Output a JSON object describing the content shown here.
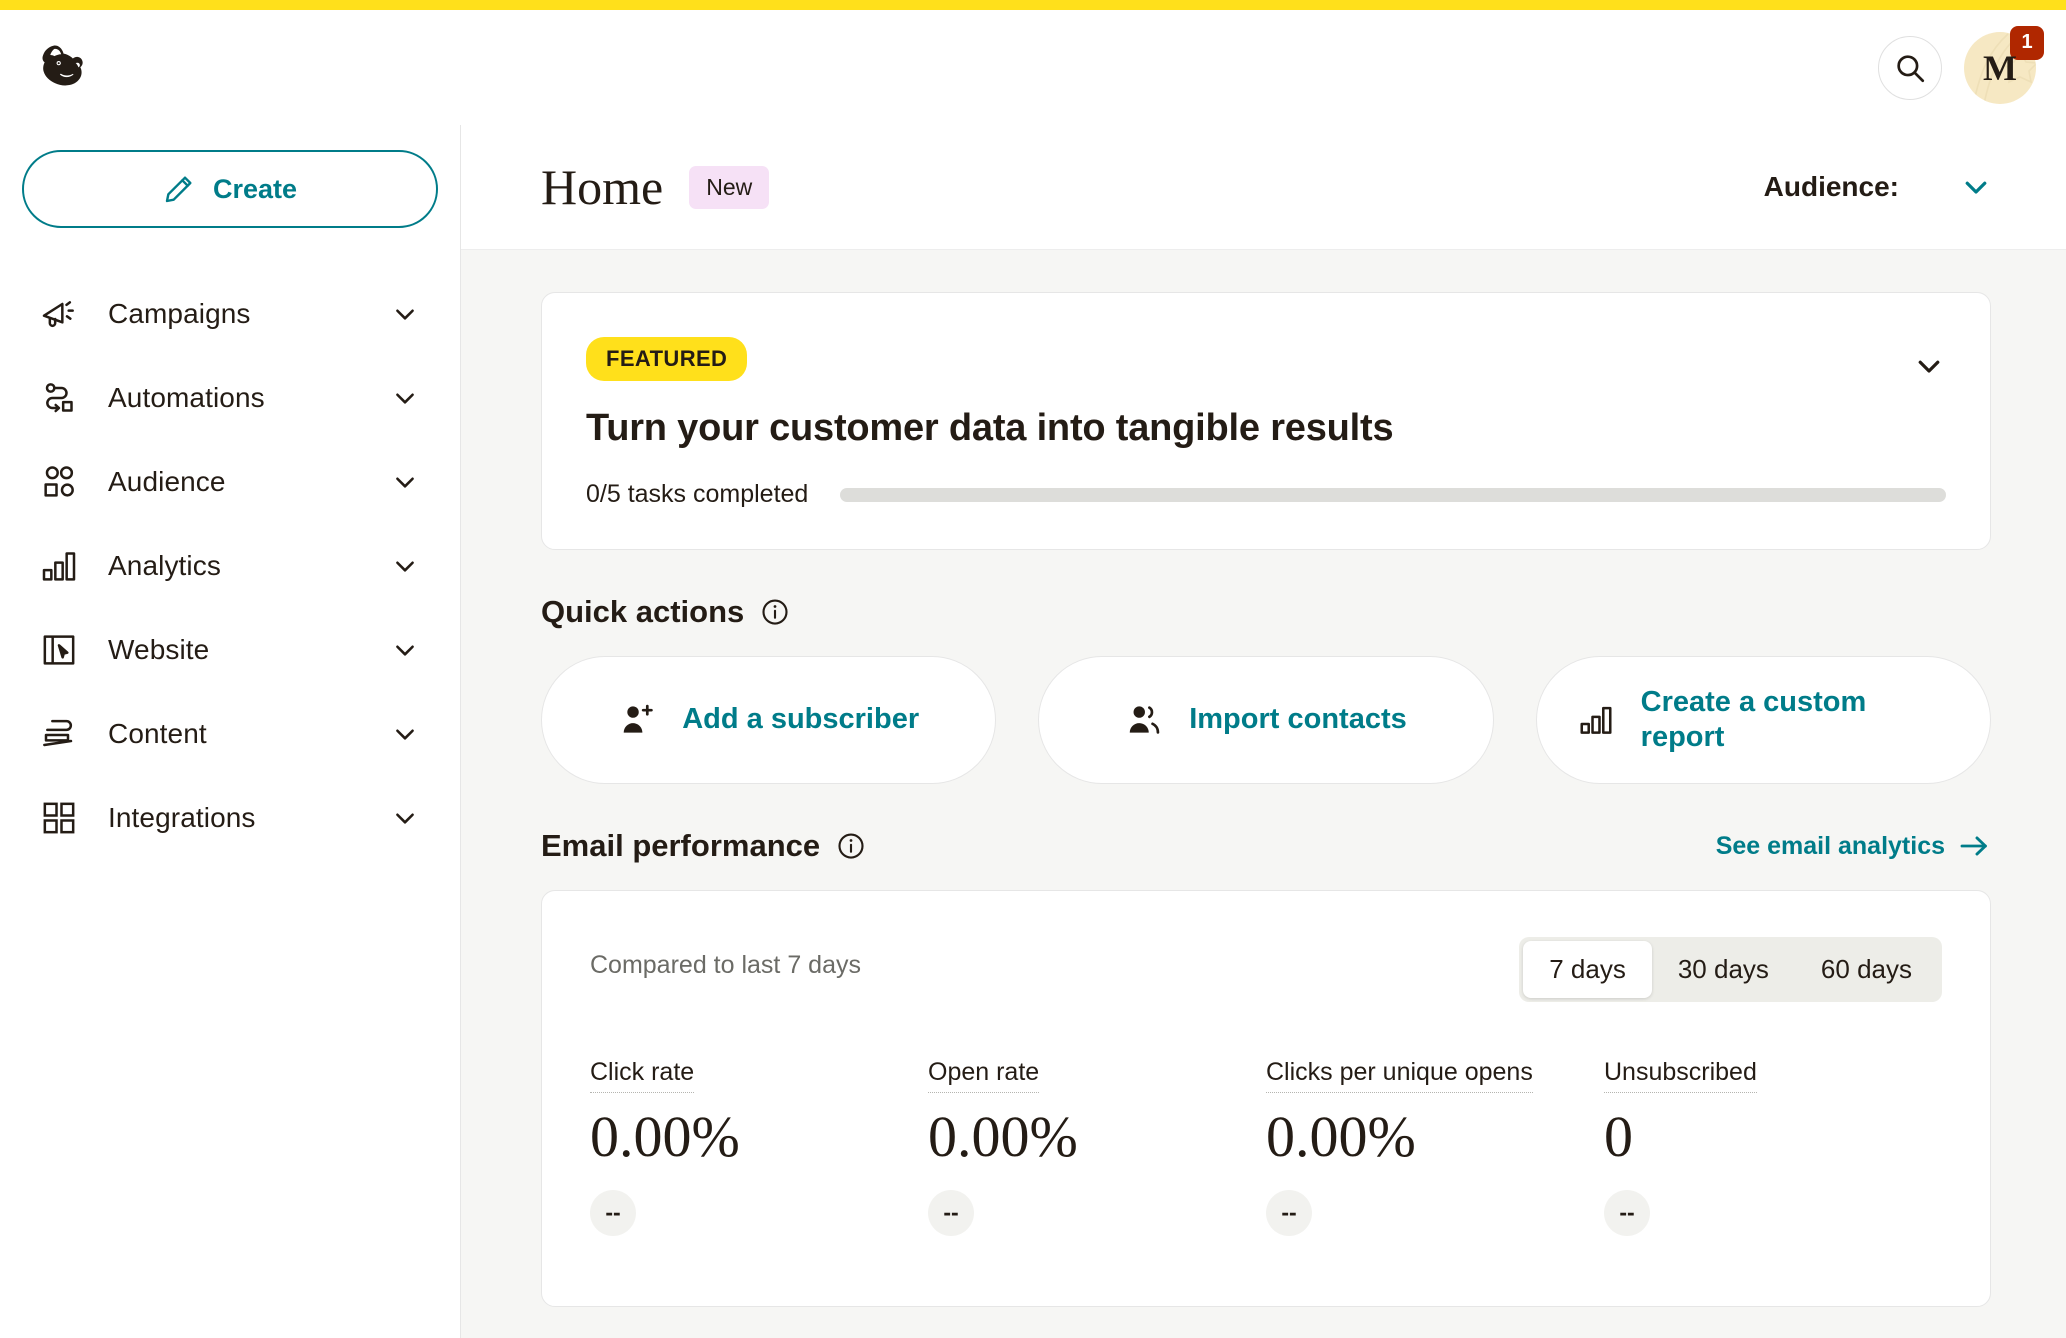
{
  "brand": {
    "accent_teal": "#007C89",
    "yellow": "#FFE01B",
    "badge_red": "#B02700",
    "page_bg": "#F6F6F4"
  },
  "header": {
    "logo_name": "mailchimp-freddie-logo",
    "search_icon": "search-icon",
    "avatar_initial": "M",
    "notification_count": "1"
  },
  "sidebar": {
    "create_label": "Create",
    "create_icon": "pencil-icon",
    "items": [
      {
        "label": "Campaigns",
        "icon": "megaphone-icon"
      },
      {
        "label": "Automations",
        "icon": "automation-flow-icon"
      },
      {
        "label": "Audience",
        "icon": "people-group-icon"
      },
      {
        "label": "Analytics",
        "icon": "bar-chart-icon"
      },
      {
        "label": "Website",
        "icon": "website-cursor-icon"
      },
      {
        "label": "Content",
        "icon": "content-stack-icon"
      },
      {
        "label": "Integrations",
        "icon": "grid-squares-icon"
      }
    ]
  },
  "page": {
    "title": "Home",
    "new_badge": "New",
    "audience_label": "Audience:",
    "audience_value": ""
  },
  "featured": {
    "badge": "FEATURED",
    "title": "Turn your customer data into tangible results",
    "tasks_text": "0/5 tasks completed",
    "progress_percent": 0,
    "collapse_icon": "chevron-down-icon"
  },
  "quick_actions": {
    "heading": "Quick actions",
    "info_icon": "info-icon",
    "cards": [
      {
        "label": "Add a subscriber",
        "icon": "person-plus-icon"
      },
      {
        "label": "Import contacts",
        "icon": "two-people-icon"
      },
      {
        "label": "Create a custom report",
        "icon": "bar-chart-icon"
      }
    ]
  },
  "email_performance": {
    "heading": "Email performance",
    "info_icon": "info-icon",
    "see_link": "See email analytics",
    "see_link_icon": "arrow-right-icon",
    "compared_text": "Compared to last 7 days",
    "ranges": [
      {
        "label": "7 days",
        "active": true
      },
      {
        "label": "30 days",
        "active": false
      },
      {
        "label": "60 days",
        "active": false
      }
    ],
    "metrics": [
      {
        "label": "Click rate",
        "value": "0.00%",
        "delta": "--"
      },
      {
        "label": "Open rate",
        "value": "0.00%",
        "delta": "--"
      },
      {
        "label": "Clicks per unique opens",
        "value": "0.00%",
        "delta": "--"
      },
      {
        "label": "Unsubscribed",
        "value": "0",
        "delta": "--"
      }
    ]
  }
}
